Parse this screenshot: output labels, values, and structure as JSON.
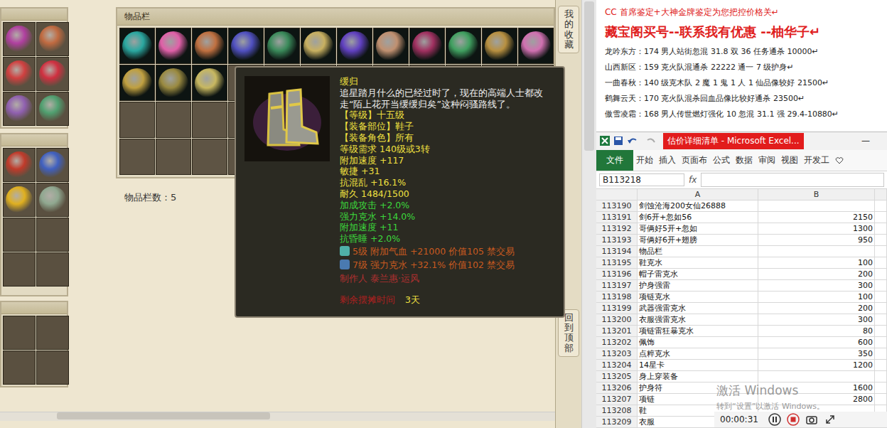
{
  "left_panels": [
    {
      "slots": [
        {
          "filled": true,
          "color": "#b040a0"
        },
        {
          "filled": true,
          "color": "#c06a40"
        },
        {
          "filled": true,
          "color": "#d04040"
        },
        {
          "filled": true,
          "color": "#d03040"
        },
        {
          "filled": true,
          "color": "#9060b0"
        },
        {
          "filled": true,
          "color": "#50a070"
        }
      ]
    },
    {
      "slots": [
        {
          "filled": true,
          "color": "#c03a2a"
        },
        {
          "filled": true,
          "color": "#4060c0"
        },
        {
          "filled": true,
          "color": "#e0b020"
        },
        {
          "filled": true,
          "color": "#90a890"
        },
        {
          "filled": false
        },
        {
          "filled": false
        },
        {
          "filled": false
        },
        {
          "filled": false
        }
      ]
    },
    {
      "slots": [
        {
          "filled": false
        },
        {
          "filled": false
        },
        {
          "filled": false
        },
        {
          "filled": false
        }
      ]
    }
  ],
  "inventory": {
    "title": "物品栏",
    "count_label": "物品栏数：5",
    "slots": [
      {
        "filled": true,
        "color": "#2aa7a0"
      },
      {
        "filled": true,
        "color": "#e060a8"
      },
      {
        "filled": true,
        "color": "#c07040"
      },
      {
        "filled": true,
        "color": "#5050c0"
      },
      {
        "filled": true,
        "color": "#3a8a5a"
      },
      {
        "filled": true,
        "color": "#c8b060"
      },
      {
        "filled": true,
        "color": "#6040c0"
      },
      {
        "filled": true,
        "color": "#c09070"
      },
      {
        "filled": true,
        "color": "#a03060"
      },
      {
        "filled": true,
        "color": "#40a060"
      },
      {
        "filled": true,
        "color": "#b89040"
      },
      {
        "filled": true,
        "color": "#d070b0"
      },
      {
        "filled": true,
        "color": "#c0a040"
      },
      {
        "filled": true,
        "color": "#9a8a40"
      },
      {
        "filled": true,
        "color": "#c8b860"
      },
      {
        "filled": false
      },
      {
        "filled": false
      },
      {
        "filled": false
      },
      {
        "filled": false
      },
      {
        "filled": false
      },
      {
        "filled": false
      },
      {
        "filled": false
      },
      {
        "filled": false
      },
      {
        "filled": false
      },
      {
        "filled": false
      },
      {
        "filled": false
      },
      {
        "filled": false
      },
      {
        "filled": false
      },
      {
        "filled": false
      },
      {
        "filled": false
      },
      {
        "filled": false
      },
      {
        "filled": false
      },
      {
        "filled": false
      },
      {
        "filled": false
      },
      {
        "filled": false
      },
      {
        "filled": false
      },
      {
        "filled": false
      },
      {
        "filled": false
      },
      {
        "filled": false
      },
      {
        "filled": false
      },
      {
        "filled": false
      },
      {
        "filled": false
      },
      {
        "filled": false
      },
      {
        "filled": false
      },
      {
        "filled": false
      },
      {
        "filled": false
      },
      {
        "filled": false
      },
      {
        "filled": false
      }
    ]
  },
  "side_strip": [
    "我的收藏",
    "回到顶部"
  ],
  "tooltip": {
    "lines": [
      {
        "kind": "title",
        "text": "缓归"
      },
      {
        "kind": "desc",
        "text": "追星踏月什么的已经过时了，现在的高端人士都改走“陌上花开当缓缓归矣”这种闷骚路线了。"
      },
      {
        "kind": "base",
        "text": "【等级】十五级"
      },
      {
        "kind": "base",
        "text": "【装备部位】鞋子"
      },
      {
        "kind": "base",
        "text": "【装备角色】所有"
      },
      {
        "kind": "base",
        "text": "等级需求 140级或3转"
      },
      {
        "kind": "base",
        "text": "附加速度 +117"
      },
      {
        "kind": "base",
        "text": "敏捷 +31"
      },
      {
        "kind": "base",
        "text": "抗混乱 +16.1%"
      },
      {
        "kind": "base",
        "text": "耐久 1484/1500"
      },
      {
        "kind": "bonus",
        "text": "加成攻击 +2.0%"
      },
      {
        "kind": "bonus",
        "text": "强力克水 +14.0%"
      },
      {
        "kind": "bonus",
        "text": "附加速度 +11"
      },
      {
        "kind": "bonus",
        "text": "抗昏睡 +2.0%"
      },
      {
        "kind": "gem",
        "text": "5级 附加气血 +21000 价值105 禁交易",
        "color": "#4fb0a8"
      },
      {
        "kind": "gem",
        "text": "7级 强力克水 +32.1% 价值102 禁交易",
        "color": "#4a7ab0"
      },
      {
        "kind": "maker",
        "text": "制作人 泰兰惠·运风"
      }
    ],
    "footer_label": "剩余摆摊时间",
    "footer_value": "3天"
  },
  "ads": [
    {
      "kind": "small",
      "text": "CC 首席鉴定+大神金牌鉴定为您把控价格关↵"
    },
    {
      "kind": "big",
      "text": "藏宝阁买号--联系我有优惠 --柚华子↵"
    },
    {
      "kind": "line",
      "text": "龙吟东方：174 男人站街忽混 31.8 双 36 任务通杀 10000↵"
    },
    {
      "kind": "line",
      "text": "山西新区：159 克火队混通杀 22222 通一 7 级护身↵"
    },
    {
      "kind": "line",
      "text": "一曲春秋：140 级克木队 2 魔 1 鬼 1 人 1 仙品像较好 21500↵"
    },
    {
      "kind": "line",
      "text": "鹤舞云天：170 克火队混杀回血品像比较好通杀 23500↵"
    },
    {
      "kind": "line",
      "text": "傲雪凌霜：168 男人传世燃灯强化 10 忽混 31.1 强 29.4-10880↵"
    }
  ],
  "excel": {
    "title": "估价详细清单 - Microsoft Excel...",
    "minimize": "—",
    "tabs": [
      {
        "label": "文件",
        "selected": true
      },
      {
        "label": "开始",
        "selected": false
      },
      {
        "label": "插入",
        "selected": false
      },
      {
        "label": "页面布",
        "selected": false
      },
      {
        "label": "公式",
        "selected": false
      },
      {
        "label": "数据",
        "selected": false
      },
      {
        "label": "审阅",
        "selected": false
      },
      {
        "label": "视图",
        "selected": false
      },
      {
        "label": "开发工",
        "selected": false
      }
    ],
    "name_box": "B113218",
    "fx": "fx",
    "columns": [
      "A",
      "B"
    ],
    "rows": [
      {
        "num": "113190",
        "a": "剑蚀沧海200女仙26888",
        "b": ""
      },
      {
        "num": "113191",
        "a": "剑6开+忽如56",
        "b": "2150"
      },
      {
        "num": "113192",
        "a": "哥俩好5开+忽如",
        "b": "1300"
      },
      {
        "num": "113193",
        "a": "哥俩好6开+翅膀",
        "b": "950"
      },
      {
        "num": "113194",
        "a": "物品栏",
        "b": ""
      },
      {
        "num": "113195",
        "a": "鞋克水",
        "b": "100"
      },
      {
        "num": "113196",
        "a": "帽子雷克水",
        "b": "200"
      },
      {
        "num": "113197",
        "a": "护身强雷",
        "b": "300"
      },
      {
        "num": "113198",
        "a": "项链克水",
        "b": "100"
      },
      {
        "num": "113199",
        "a": "武器强雷克水",
        "b": "200"
      },
      {
        "num": "113200",
        "a": "衣服强雷克水",
        "b": "300"
      },
      {
        "num": "113201",
        "a": "项链雷狂暴克水",
        "b": "80"
      },
      {
        "num": "113202",
        "a": "佩饰",
        "b": "600"
      },
      {
        "num": "113203",
        "a": "点粹克水",
        "b": "350"
      },
      {
        "num": "113204",
        "a": "14星卡",
        "b": "1200"
      },
      {
        "num": "113205",
        "a": "身上穿装备",
        "b": ""
      },
      {
        "num": "113206",
        "a": "护身符",
        "b": "1600"
      },
      {
        "num": "113207",
        "a": "项链",
        "b": "2800"
      },
      {
        "num": "113208",
        "a": "鞋",
        "b": ""
      },
      {
        "num": "113209",
        "a": "衣服",
        "b": ""
      }
    ]
  },
  "watermark": {
    "title": "激活 Windows",
    "subtitle": "转到“设置”以激活 Windows。"
  },
  "recorder": {
    "time": "00:00:31"
  }
}
